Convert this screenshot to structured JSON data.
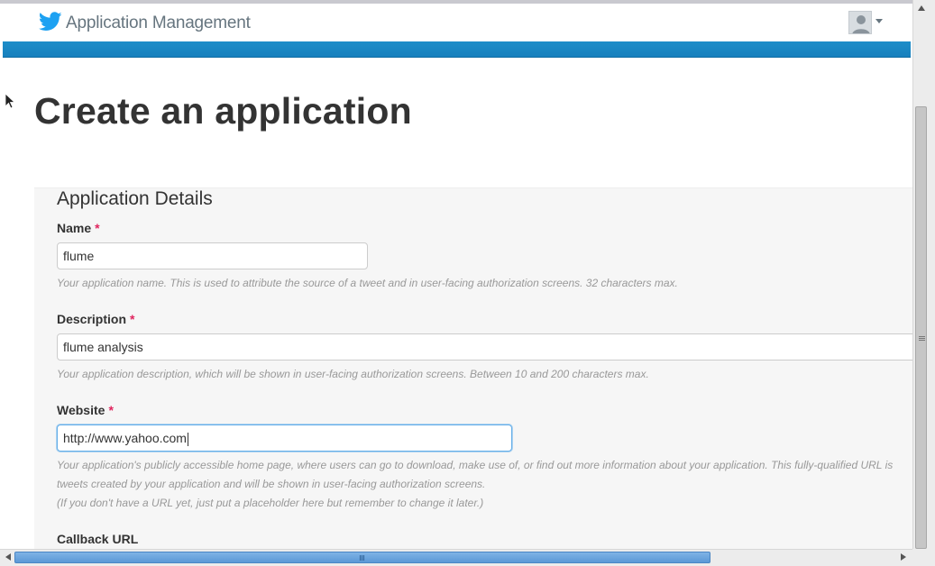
{
  "header": {
    "app_title": "Application Management",
    "logo_icon": "twitter-bird-icon",
    "avatar_icon": "user-avatar-icon",
    "menu_icon": "caret-down-icon",
    "brand_color": "#1da1f2",
    "band_color": "#1780bd"
  },
  "page": {
    "title": "Create an application"
  },
  "form": {
    "section_title": "Application Details",
    "name": {
      "label": "Name",
      "required_mark": "*",
      "value": "flume",
      "help": "Your application name. This is used to attribute the source of a tweet and in user-facing authorization screens. 32 characters max."
    },
    "description": {
      "label": "Description",
      "required_mark": "*",
      "value": "flume analysis",
      "help": "Your application description, which will be shown in user-facing authorization screens. Between 10 and 200 characters max."
    },
    "website": {
      "label": "Website",
      "required_mark": "*",
      "value": "http://www.yahoo.com",
      "help_line1": "Your application's publicly accessible home page, where users can go to download, make use of, or find out more information about your application. This fully-qualified URL is",
      "help_line2": "tweets created by your application and will be shown in user-facing authorization screens.",
      "help_line3": "(If you don't have a URL yet, just put a placeholder here but remember to change it later.)"
    },
    "callback": {
      "label": "Callback URL"
    }
  }
}
